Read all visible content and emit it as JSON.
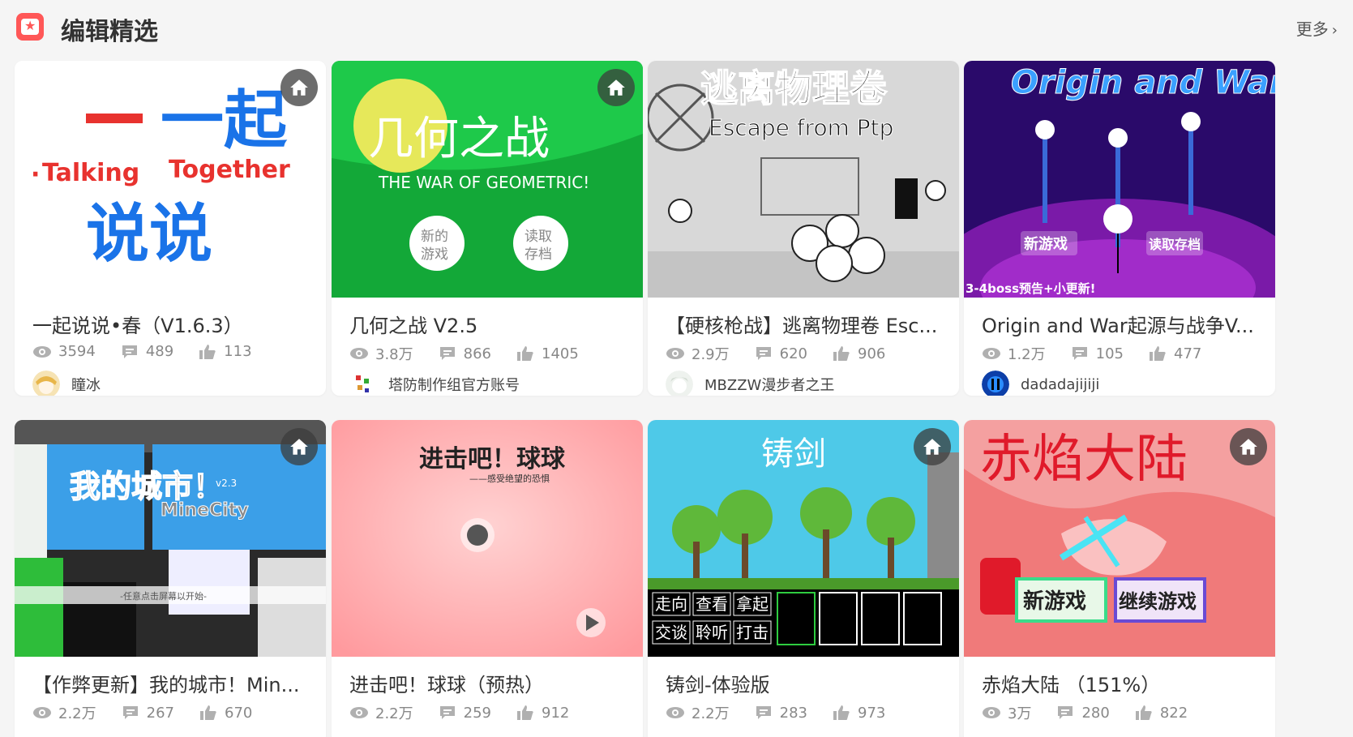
{
  "header": {
    "title": "编辑精选",
    "more_label": "更多",
    "accent": "#ff5757"
  },
  "cards": [
    {
      "name": "一起说说•春（V1.6.3）",
      "views": "3594",
      "comments": "489",
      "likes": "113",
      "author": "瞳冰",
      "thumb": {
        "title": "一起",
        "subtitle_left": "Talking",
        "subtitle_right": "Together",
        "title2": "说说"
      }
    },
    {
      "name": "几何之战 V2.5",
      "views": "3.8万",
      "comments": "866",
      "likes": "1405",
      "author": "塔防制作组官方账号",
      "thumb": {
        "title": "几何之战",
        "subtitle": "THE WAR OF GEOMETRIC!",
        "btn_left": "新的游戏",
        "btn_right": "读取存档"
      }
    },
    {
      "name": "【硬核枪战】逃离物理卷 Esc...",
      "views": "2.9万",
      "comments": "620",
      "likes": "906",
      "author": "MBZZW漫步者之王",
      "thumb": {
        "title": "逃离物理卷",
        "subtitle": "Escape from Ptp"
      }
    },
    {
      "name": "Origin and War起源与战争V...",
      "views": "1.2万",
      "comments": "105",
      "likes": "477",
      "author": "dadadajijiji",
      "thumb": {
        "title": "Origin and War",
        "btn_left": "新游戏",
        "btn_right": "读取存档",
        "banner": "3-4boss预告+小更新!"
      }
    },
    {
      "name": "【作弊更新】我的城市！Min...",
      "views": "2.2万",
      "comments": "267",
      "likes": "670",
      "author": "",
      "thumb": {
        "title": "我的城市！",
        "subtitle": "MineCity",
        "version": "v2.3",
        "hint": "-任意点击屏幕以开始-"
      }
    },
    {
      "name": "进击吧！球球（预热）",
      "views": "2.2万",
      "comments": "259",
      "likes": "912",
      "author": "",
      "thumb": {
        "title": "进击吧！球球",
        "subtitle": "——感受绝望的恐惧"
      }
    },
    {
      "name": "铸剑-体验版",
      "views": "2.2万",
      "comments": "283",
      "likes": "973",
      "author": "",
      "thumb": {
        "title": "铸剑",
        "actions_row1": [
          "走向",
          "查看",
          "拿起"
        ],
        "actions_row2": [
          "交谈",
          "聆听",
          "打击"
        ]
      }
    },
    {
      "name": "赤焰大陆 （151%）",
      "views": "3万",
      "comments": "280",
      "likes": "822",
      "author": "",
      "thumb": {
        "title": "赤焰大陆",
        "btn_left": "新游戏",
        "btn_right": "继续游戏"
      }
    }
  ]
}
